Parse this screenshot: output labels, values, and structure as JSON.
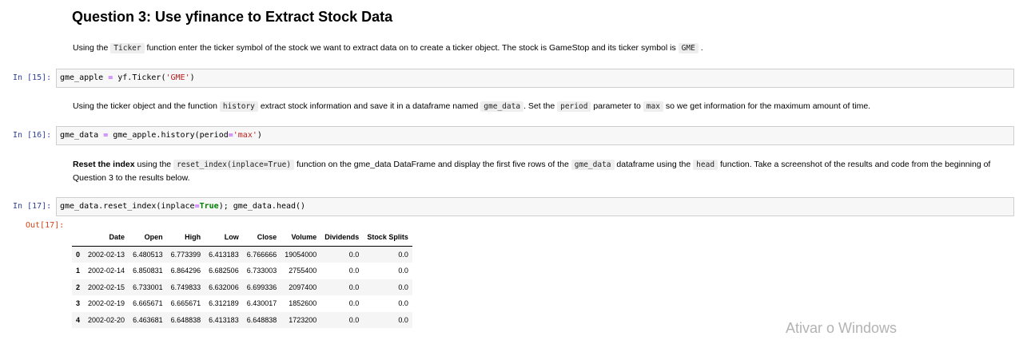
{
  "heading": "Question 3: Use yfinance to Extract Stock Data",
  "p1": {
    "t1": "Using the ",
    "c1": "Ticker",
    "t2": " function enter the ticker symbol of the stock we want to extract data on to create a ticker object. The stock is GameStop and its ticker symbol is ",
    "c2": "GME",
    "t3": " ."
  },
  "cell15": {
    "prompt": "In [15]:",
    "a": "gme_apple ",
    "eq": "=",
    "b": " yf.Ticker(",
    "str": "'GME'",
    "c": ")"
  },
  "p2": {
    "t1": "Using the ticker object and the function ",
    "c1": "history",
    "t2": " extract stock information and save it in a dataframe named ",
    "c2": "gme_data",
    "t3": ". Set the ",
    "c3": "period",
    "t4": " parameter to ",
    "c4": "max",
    "t5": " so we get information for the maximum amount of time."
  },
  "cell16": {
    "prompt": "In [16]:",
    "a": "gme_data ",
    "eq": "=",
    "b": " gme_apple.history(period",
    "eq2": "=",
    "str": "'max'",
    "c": ")"
  },
  "p3": {
    "bold": "Reset the index",
    "t1": " using the ",
    "c1": "reset_index(inplace=True)",
    "t2": " function on the gme_data DataFrame and display the first five rows of the ",
    "c2": "gme_data",
    "t3": " dataframe using the ",
    "c3": "head",
    "t4": " function. Take a screenshot of the results and code from the beginning of Question 3 to the results below."
  },
  "cell17": {
    "prompt": "In [17]:",
    "a": "gme_data.reset_index(inplace",
    "eq": "=",
    "kw": "True",
    "b": "); gme_data.head()"
  },
  "out17": {
    "prompt": "Out[17]:"
  },
  "table": {
    "columns": [
      "",
      "Date",
      "Open",
      "High",
      "Low",
      "Close",
      "Volume",
      "Dividends",
      "Stock Splits"
    ],
    "rows": [
      [
        "0",
        "2002-02-13",
        "6.480513",
        "6.773399",
        "6.413183",
        "6.766666",
        "19054000",
        "0.0",
        "0.0"
      ],
      [
        "1",
        "2002-02-14",
        "6.850831",
        "6.864296",
        "6.682506",
        "6.733003",
        "2755400",
        "0.0",
        "0.0"
      ],
      [
        "2",
        "2002-02-15",
        "6.733001",
        "6.749833",
        "6.632006",
        "6.699336",
        "2097400",
        "0.0",
        "0.0"
      ],
      [
        "3",
        "2002-02-19",
        "6.665671",
        "6.665671",
        "6.312189",
        "6.430017",
        "1852600",
        "0.0",
        "0.0"
      ],
      [
        "4",
        "2002-02-20",
        "6.463681",
        "6.648838",
        "6.413183",
        "6.648838",
        "1723200",
        "0.0",
        "0.0"
      ]
    ]
  },
  "watermark": "Ativar o Windows"
}
